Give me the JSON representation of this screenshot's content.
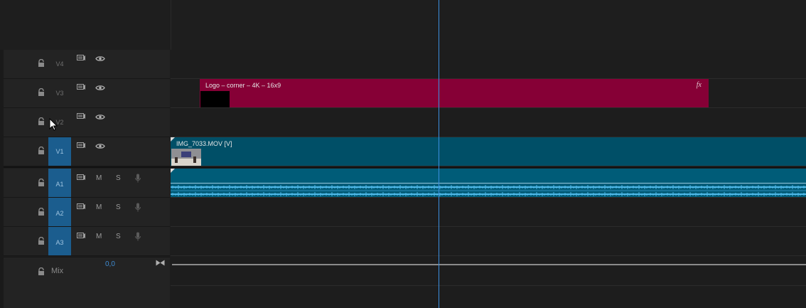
{
  "tracks": {
    "video": [
      {
        "name": "V4"
      },
      {
        "name": "V3"
      },
      {
        "name": "V2"
      },
      {
        "name": "V1"
      }
    ],
    "audio": [
      {
        "name": "A1",
        "mute": "M",
        "solo": "S"
      },
      {
        "name": "A2",
        "mute": "M",
        "solo": "S"
      },
      {
        "name": "A3",
        "mute": "M",
        "solo": "S"
      }
    ],
    "mix": {
      "label": "Mix",
      "value": "0,0"
    }
  },
  "clips": {
    "logo": {
      "name": "Logo – corner – 4K – 16x9",
      "fx": "fx",
      "color": "#860036"
    },
    "video": {
      "name": "IMG_7033.MOV [V]",
      "color": "#004f67"
    },
    "audio": {
      "color": "#005c78",
      "waveform": "#4fb8e8"
    }
  },
  "accent": "#3c8fe0"
}
